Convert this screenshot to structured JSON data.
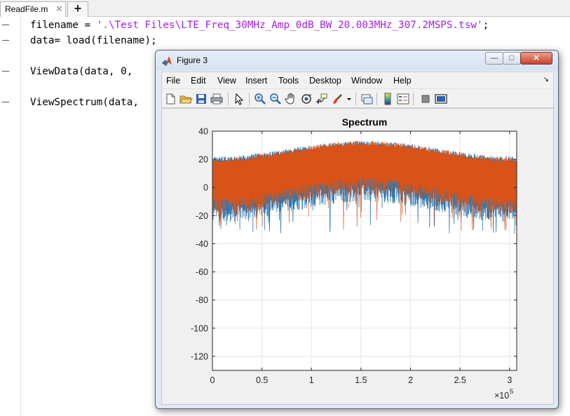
{
  "editor": {
    "tab_label": "ReadFile.m",
    "tab_close_glyph": "✕",
    "add_tab_glyph": "+",
    "lines": [
      {
        "pre": "filename = ",
        "str": "'.\\Test Files\\LTE_Freq_30MHz_Amp_0dB_BW_20.003MHz_307.2MSPS.tsw'",
        "post": ";"
      },
      {
        "pre": "data= load(filename);",
        "str": "",
        "post": ""
      },
      {
        "pre": "ViewData(data, 0,",
        "str": "",
        "post": ""
      },
      {
        "pre": "ViewSpectrum(data,",
        "str": "",
        "post": ""
      }
    ]
  },
  "figure_window": {
    "title": "Figure 3",
    "min_glyph": "—",
    "max_glyph": "□",
    "close_glyph": "✕",
    "menu": [
      "File",
      "Edit",
      "View",
      "Insert",
      "Tools",
      "Desktop",
      "Window",
      "Help"
    ],
    "menu_arrow_glyph": "↘",
    "toolbar_icons": [
      "new-figure-icon",
      "open-file-icon",
      "save-icon",
      "print-icon",
      "pointer-icon",
      "zoom-in-icon",
      "zoom-out-icon",
      "pan-icon",
      "rotate-3d-icon",
      "data-cursor-icon",
      "brush-icon",
      "brush-menu-icon",
      "link-plot-icon",
      "colorbar-icon",
      "legend-icon",
      "hide-plot-tools-icon",
      "show-plot-tools-icon"
    ]
  },
  "chart_data": {
    "type": "line",
    "title": "Spectrum",
    "xlabel": "",
    "ylabel": "",
    "xlim": [
      0,
      307200
    ],
    "ylim": [
      -130,
      40
    ],
    "x_ticks": [
      0,
      0.5,
      1,
      1.5,
      2,
      2.5,
      3
    ],
    "x_tick_labels": [
      "0",
      "0.5",
      "1",
      "1.5",
      "2",
      "2.5",
      "3"
    ],
    "x_exponent_label": "×10",
    "x_exponent_power": "5",
    "y_ticks": [
      40,
      20,
      0,
      -20,
      -40,
      -60,
      -80,
      -100,
      -120
    ],
    "y_tick_labels": [
      "40",
      "20",
      "0",
      "-20",
      "-40",
      "-60",
      "-80",
      "-100",
      "-120"
    ],
    "grid": true,
    "series": [
      {
        "color": "#2878b5",
        "upper_envelope": [
          [
            0,
            22
          ],
          [
            153600,
            33
          ],
          [
            307200,
            22
          ]
        ],
        "lower_envelope": [
          [
            0,
            -25
          ],
          [
            153600,
            -10
          ],
          [
            307200,
            -25
          ]
        ],
        "min_spike": -33
      },
      {
        "color": "#d95319",
        "upper_envelope": [
          [
            0,
            21
          ],
          [
            153600,
            33
          ],
          [
            307200,
            21
          ]
        ],
        "lower_envelope": [
          [
            0,
            -20
          ],
          [
            153600,
            -5
          ],
          [
            307200,
            -20
          ]
        ],
        "min_spike": -31
      }
    ]
  }
}
